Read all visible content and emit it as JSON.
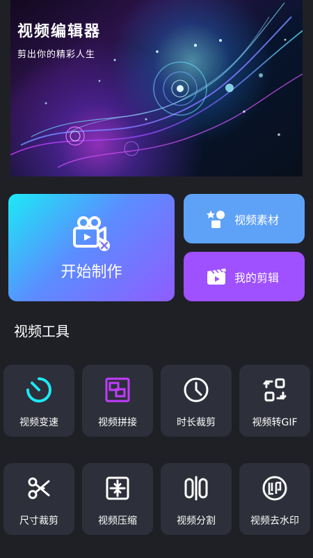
{
  "banner": {
    "title": "视频编辑器",
    "subtitle": "剪出你的精彩人生"
  },
  "actions": {
    "start": "开始制作",
    "materials": "视频素材",
    "my_edits": "我的剪辑"
  },
  "section": {
    "tools_title": "视频工具"
  },
  "tools": [
    {
      "label": "视频变速",
      "icon": "speed-gauge-icon"
    },
    {
      "label": "视频拼接",
      "icon": "splice-frame-icon"
    },
    {
      "label": "时长裁剪",
      "icon": "clock-icon"
    },
    {
      "label": "视频转GIF",
      "icon": "convert-gif-icon"
    },
    {
      "label": "尺寸裁剪",
      "icon": "scissors-icon"
    },
    {
      "label": "视频压缩",
      "icon": "compress-icon"
    },
    {
      "label": "视频分割",
      "icon": "split-icon"
    },
    {
      "label": "视频去水印",
      "icon": "watermark-stamp-icon"
    }
  ],
  "colors": {
    "background": "#1f2026",
    "card_bg": "#2d2f3a",
    "start_gradient": [
      "#1ce9f5",
      "#5b8dff",
      "#8f5cff"
    ],
    "materials_bg": "#5ea2f8",
    "my_edits_bg": "#9f50ff",
    "accent_cyan": "#1ce9f5",
    "accent_purple": "#c33cff"
  }
}
